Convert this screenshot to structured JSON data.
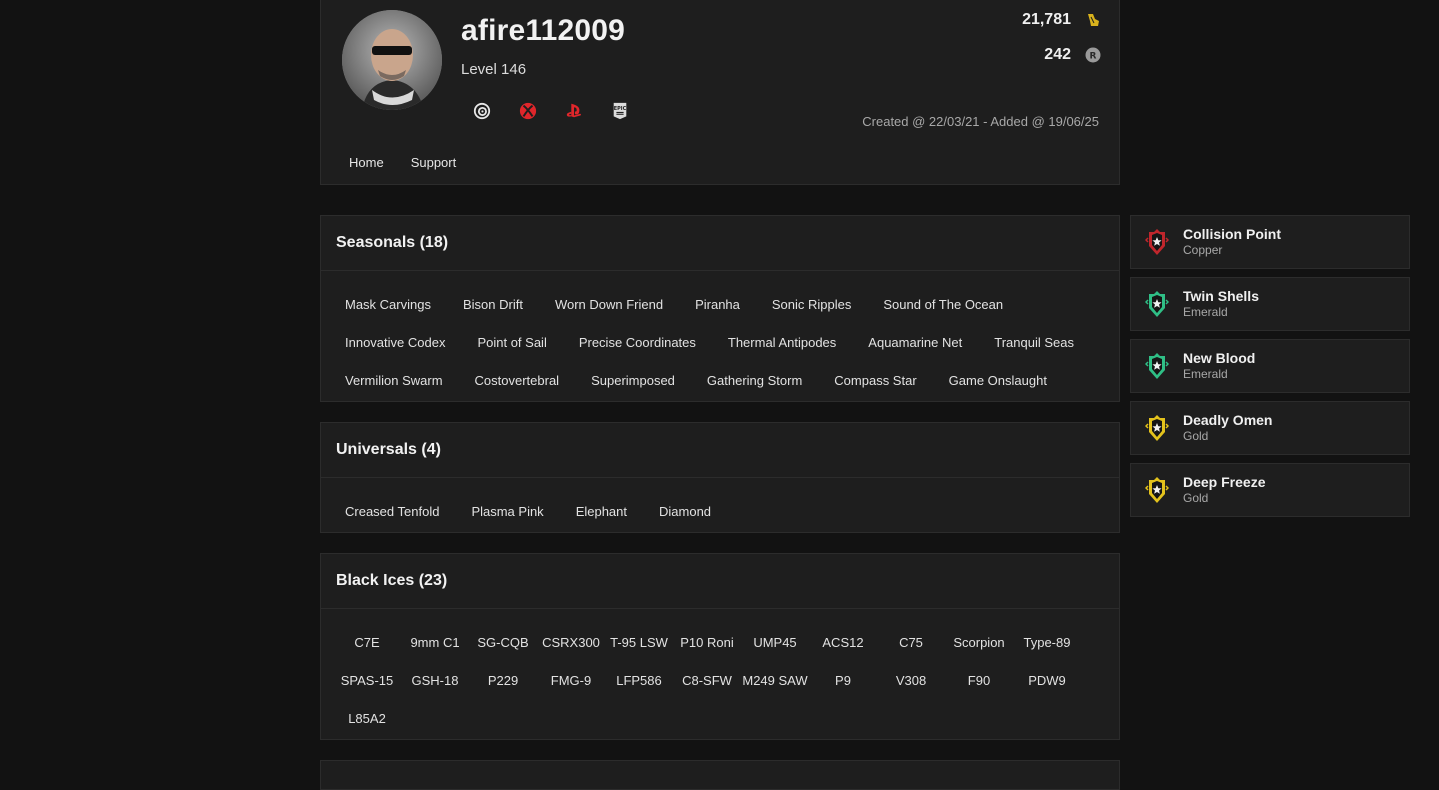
{
  "profile": {
    "username": "afire112009",
    "level": "Level 146",
    "credits": "21,781",
    "renown": "242",
    "dates": "Created @ 22/03/21 - Added @ 19/06/25",
    "platforms": [
      "ubisoft-icon",
      "xbox-icon",
      "playstation-icon",
      "epic-games-icon"
    ],
    "nav": [
      "Home",
      "Support"
    ]
  },
  "sections": {
    "seasonals": {
      "title": "Seasonals (18)",
      "items": [
        "Mask Carvings",
        "Bison Drift",
        "Worn Down Friend",
        "Piranha",
        "Sonic Ripples",
        "Sound of The Ocean",
        "Innovative Codex",
        "Point of Sail",
        "Precise Coordinates",
        "Thermal Antipodes",
        "Aquamarine Net",
        "Tranquil Seas",
        "Vermilion Swarm",
        "Costovertebral",
        "Superimposed",
        "Gathering Storm",
        "Compass Star",
        "Game Onslaught"
      ]
    },
    "universals": {
      "title": "Universals (4)",
      "items": [
        "Creased Tenfold",
        "Plasma Pink",
        "Elephant",
        "Diamond"
      ]
    },
    "blackices": {
      "title": "Black Ices (23)",
      "items": [
        "C7E",
        "9mm C1",
        "SG-CQB",
        "CSRX300",
        "T-95 LSW",
        "P10 Roni",
        "UMP45",
        "ACS12",
        "C75",
        "Scorpion",
        "Type-89",
        "SPAS-15",
        "GSH-18",
        "P229",
        "FMG-9",
        "LFP586",
        "C8-SFW",
        "M249 SAW",
        "P9",
        "V308",
        "F90",
        "PDW9",
        "L85A2"
      ]
    }
  },
  "ranks": [
    {
      "name": "Collision Point",
      "tier": "Copper",
      "color": "#c0262c"
    },
    {
      "name": "Twin Shells",
      "tier": "Emerald",
      "color": "#2fbf86"
    },
    {
      "name": "New Blood",
      "tier": "Emerald",
      "color": "#2fbf86"
    },
    {
      "name": "Deadly Omen",
      "tier": "Gold",
      "color": "#e3c21c"
    },
    {
      "name": "Deep Freeze",
      "tier": "Gold",
      "color": "#e3c21c"
    }
  ],
  "colors": {
    "background": "#121212",
    "panel": "#1e1e1e",
    "border": "#2c2c2c",
    "credits_icon": "#d9b21c",
    "xbox": "#e0262b",
    "playstation": "#e0262b"
  }
}
